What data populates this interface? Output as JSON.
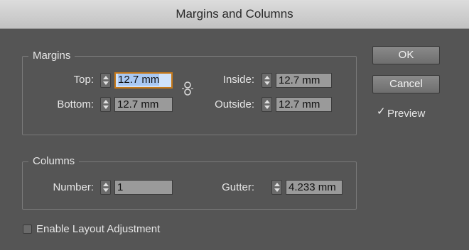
{
  "window": {
    "title": "Margins and Columns"
  },
  "margins": {
    "label": "Margins",
    "top": {
      "label": "Top:",
      "value": "12.7 mm"
    },
    "bottom": {
      "label": "Bottom:",
      "value": "12.7 mm"
    },
    "inside": {
      "label": "Inside:",
      "value": "12.7 mm"
    },
    "outside": {
      "label": "Outside:",
      "value": "12.7 mm"
    },
    "link_icon": "chain-link-icon"
  },
  "columns": {
    "label": "Columns",
    "number": {
      "label": "Number:",
      "value": "1"
    },
    "gutter": {
      "label": "Gutter:",
      "value": "4.233 mm"
    }
  },
  "buttons": {
    "ok": "OK",
    "cancel": "Cancel"
  },
  "preview": {
    "label": "Preview",
    "checked": true
  },
  "layout_adjustment": {
    "label": "Enable Layout Adjustment",
    "checked": false
  },
  "colors": {
    "dialog_bg": "#555555",
    "title_bg": "#c8c8c8",
    "focus_ring": "#c77a1a",
    "field_bg": "#9a9a9a"
  }
}
